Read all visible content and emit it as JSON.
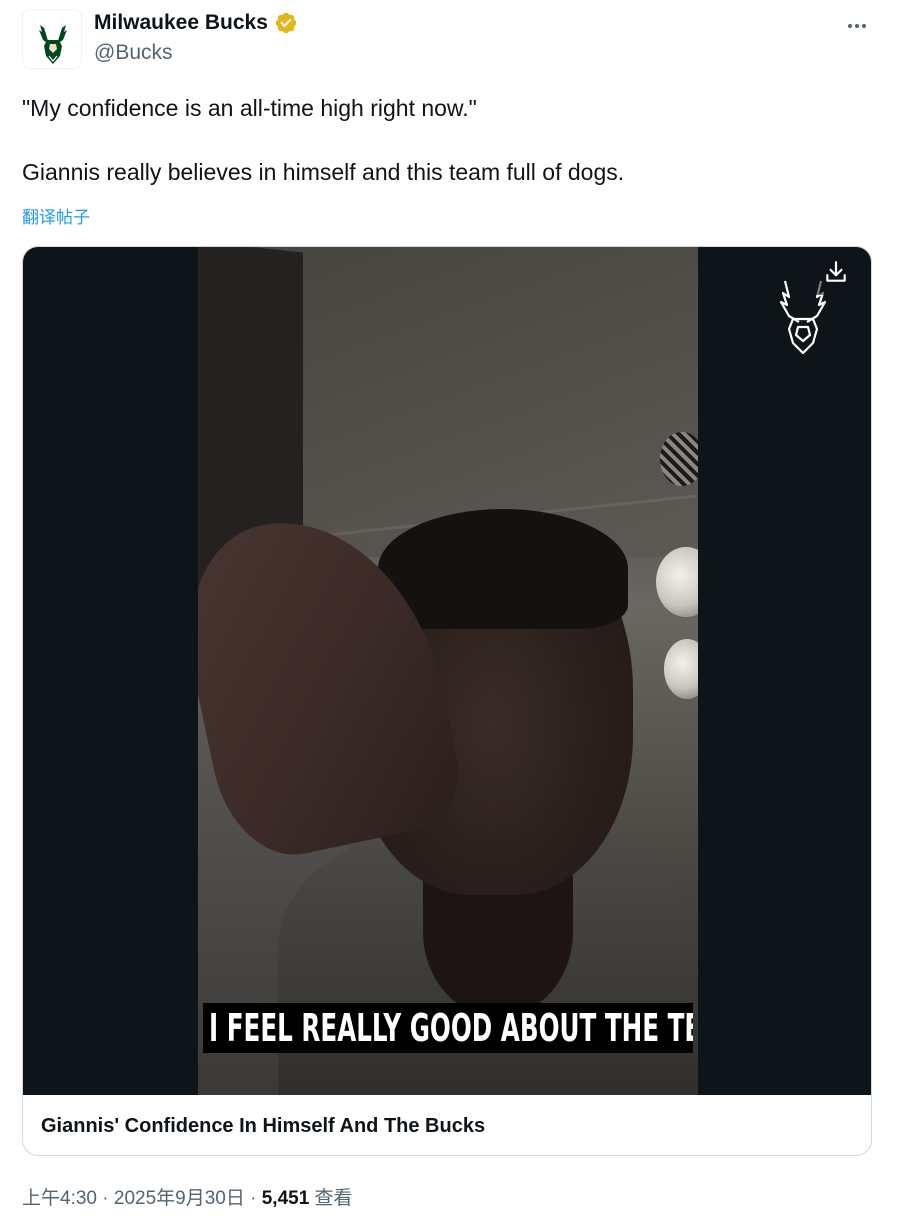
{
  "author": {
    "display_name": "Milwaukee Bucks",
    "handle": "@Bucks",
    "verified_icon": "verified-badge-gold",
    "avatar_icon": "bucks-deer-logo"
  },
  "tweet": {
    "text": "\"My confidence is an all-time high right now.\"\n\nGiannis really believes in himself and this team full of dogs.",
    "translate_label": "翻译帖子"
  },
  "media": {
    "caption": "I FEEL REALLY GOOD ABOUT THE TEAM.",
    "card_title": "Giannis' Confidence In Himself And The Bucks",
    "download_icon": "download-icon",
    "watermark_icon": "bucks-deer-logo"
  },
  "meta": {
    "time": "上午4:30",
    "sep1": " · ",
    "date": "2025年9月30日",
    "sep2": " · ",
    "views_count": "5,451",
    "views_label": " 查看"
  },
  "colors": {
    "text": "#0f1419",
    "secondary": "#536471",
    "link": "#1d9bf0",
    "bucks_green": "#00471b",
    "verified_gold": "#e2b719"
  }
}
